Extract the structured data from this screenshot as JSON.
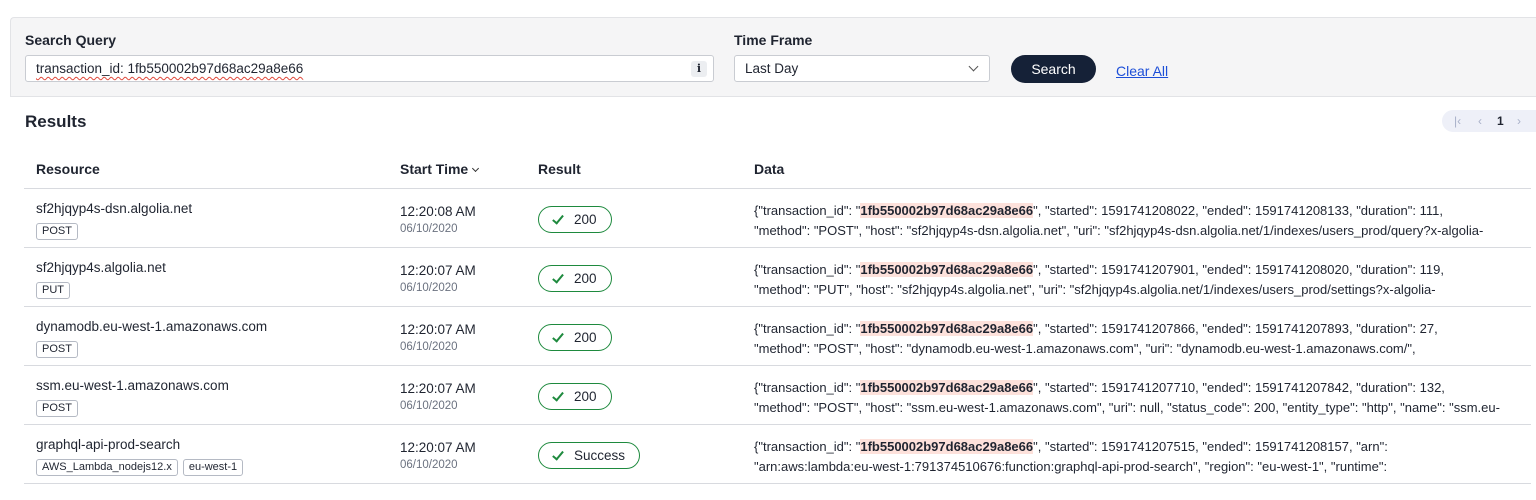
{
  "search": {
    "query_label": "Search Query",
    "query_value": "transaction_id: 1fb550002b97d68ac29a8e66",
    "info_glyph": "i",
    "time_label": "Time Frame",
    "time_value": "Last Day",
    "search_button": "Search",
    "clear_link": "Clear All"
  },
  "results": {
    "title": "Results",
    "pager": {
      "first": "|‹",
      "prev": "‹",
      "page": "1",
      "next": "›"
    },
    "columns": {
      "resource": "Resource",
      "start_time": "Start Time",
      "result": "Result",
      "data": "Data"
    },
    "highlight": "1fb550002b97d68ac29a8e66",
    "rows": [
      {
        "resource": "sf2hjqyp4s-dsn.algolia.net",
        "tags": [
          "POST"
        ],
        "time": "12:20:08 AM",
        "date": "06/10/2020",
        "result": "200",
        "data_pre": "{\"transaction_id\": \"",
        "data_post": "\", \"started\": 1591741208022, \"ended\": 1591741208133, \"duration\": 111,",
        "data_line2": "\"method\": \"POST\", \"host\": \"sf2hjqyp4s-dsn.algolia.net\", \"uri\": \"sf2hjqyp4s-dsn.algolia.net/1/indexes/users_prod/query?x-algolia-"
      },
      {
        "resource": "sf2hjqyp4s.algolia.net",
        "tags": [
          "PUT"
        ],
        "time": "12:20:07 AM",
        "date": "06/10/2020",
        "result": "200",
        "data_pre": "{\"transaction_id\": \"",
        "data_post": "\", \"started\": 1591741207901, \"ended\": 1591741208020, \"duration\": 119,",
        "data_line2": "\"method\": \"PUT\", \"host\": \"sf2hjqyp4s.algolia.net\", \"uri\": \"sf2hjqyp4s.algolia.net/1/indexes/users_prod/settings?x-algolia-"
      },
      {
        "resource": "dynamodb.eu-west-1.amazonaws.com",
        "tags": [
          "POST"
        ],
        "time": "12:20:07 AM",
        "date": "06/10/2020",
        "result": "200",
        "data_pre": "{\"transaction_id\": \"",
        "data_post": "\", \"started\": 1591741207866, \"ended\": 1591741207893, \"duration\": 27,",
        "data_line2": "\"method\": \"POST\", \"host\": \"dynamodb.eu-west-1.amazonaws.com\", \"uri\": \"dynamodb.eu-west-1.amazonaws.com/\","
      },
      {
        "resource": "ssm.eu-west-1.amazonaws.com",
        "tags": [
          "POST"
        ],
        "time": "12:20:07 AM",
        "date": "06/10/2020",
        "result": "200",
        "data_pre": "{\"transaction_id\": \"",
        "data_post": "\", \"started\": 1591741207710, \"ended\": 1591741207842, \"duration\": 132,",
        "data_line2": "\"method\": \"POST\", \"host\": \"ssm.eu-west-1.amazonaws.com\", \"uri\": null, \"status_code\": 200, \"entity_type\": \"http\", \"name\": \"ssm.eu-"
      },
      {
        "resource": "graphql-api-prod-search",
        "tags": [
          "AWS_Lambda_nodejs12.x",
          "eu-west-1"
        ],
        "time": "12:20:07 AM",
        "date": "06/10/2020",
        "result": "Success",
        "data_pre": "{\"transaction_id\": \"",
        "data_post": "\", \"started\": 1591741207515, \"ended\": 1591741208157, \"arn\":",
        "data_line2": "\"arn:aws:lambda:eu-west-1:791374510676:function:graphql-api-prod-search\", \"region\": \"eu-west-1\", \"runtime\":"
      }
    ]
  },
  "colors": {
    "search_button": "#152137",
    "success": "#1e8a3e",
    "highlight": "#fde1db",
    "link": "#1d4fd8"
  }
}
